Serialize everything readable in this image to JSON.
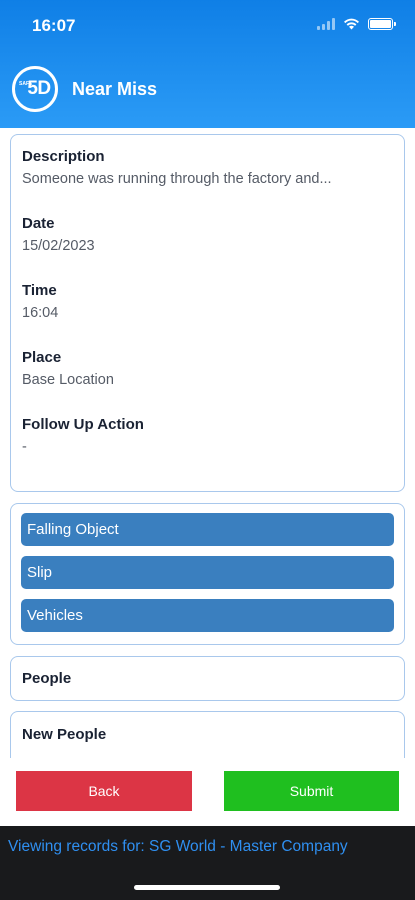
{
  "status_bar": {
    "time": "16:07"
  },
  "header": {
    "logo_text": "5D",
    "logo_small_text": "SAFE",
    "title": "Near Miss"
  },
  "details": [
    {
      "label": "Description",
      "value": "Someone was running through the factory and..."
    },
    {
      "label": "Date",
      "value": "15/02/2023"
    },
    {
      "label": "Time",
      "value": "16:04"
    },
    {
      "label": "Place",
      "value": "Base Location"
    },
    {
      "label": "Follow Up Action",
      "value": "-"
    }
  ],
  "tags": [
    "Falling Object",
    "Slip",
    "Vehicles"
  ],
  "sections": {
    "people": "People",
    "new_people": "New People"
  },
  "buttons": {
    "back": "Back",
    "submit": "Submit"
  },
  "footer": {
    "text": "Viewing records for: SG World - Master Company"
  },
  "colors": {
    "header_blue": "#1a8bf0",
    "tag_blue": "#3a7fbf",
    "back_red": "#dc3545",
    "submit_green": "#1fbf1f",
    "footer_link": "#2f8ff0"
  }
}
